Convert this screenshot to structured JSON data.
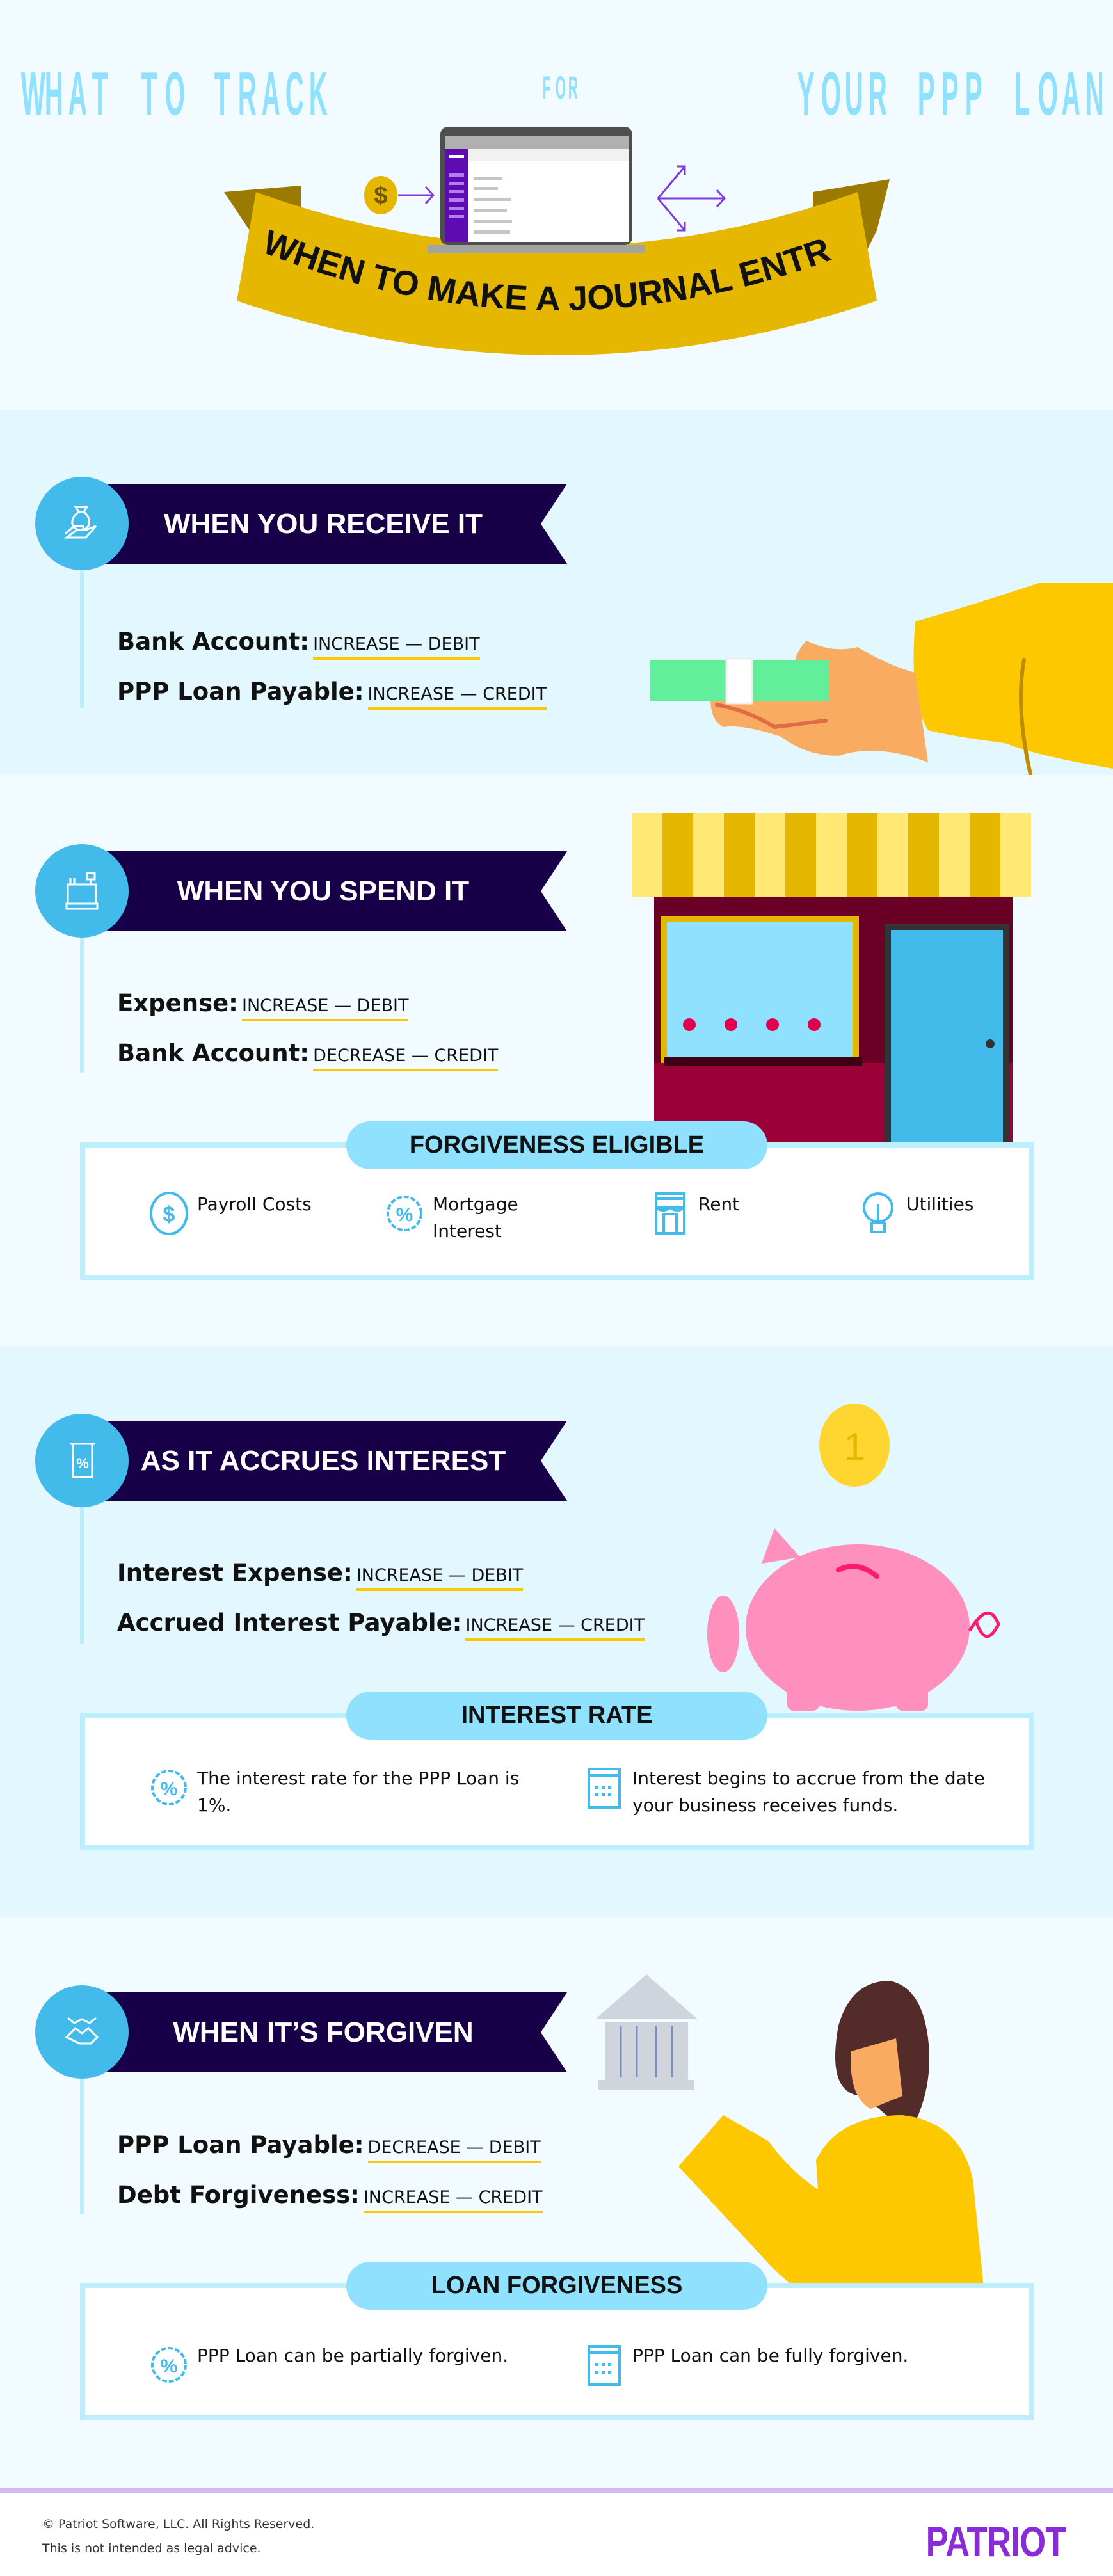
{
  "header": {
    "title_part1": "WHAT TO TRACK",
    "title_small": "FOR",
    "title_part2": "YOUR PPP LOAN",
    "ribbon_text": "WHEN TO MAKE A JOURNAL ENTRY",
    "icons": [
      "dollar-coin-icon",
      "laptop-icon",
      "branching-arrows-icon"
    ]
  },
  "colors": {
    "title": "#8fe1fd",
    "banner": "#170047",
    "circle": "#42bbeb",
    "pill": "#8fe1fd",
    "box_border": "#bdeefc",
    "underline": "#fdc800",
    "ribbon": "#e5b700",
    "logo": "#8a2bd8",
    "footer_line": "#d7b6f6"
  },
  "sections": [
    {
      "title": "WHEN YOU RECEIVE IT",
      "icon": "money-bag-hand-icon",
      "entries": [
        {
          "account": "Bank Account:",
          "value": "INCREASE — DEBIT"
        },
        {
          "account": "PPP Loan Payable:",
          "value": "INCREASE — CREDIT"
        }
      ],
      "illustration": "hand-holding-cash"
    },
    {
      "title": "WHEN YOU SPEND IT",
      "icon": "cash-register-icon",
      "entries": [
        {
          "account": "Expense:",
          "value": "INCREASE — DEBIT"
        },
        {
          "account": "Bank Account:",
          "value": "DECREASE — CREDIT"
        }
      ],
      "illustration": "storefront",
      "box": {
        "title": "FORGIVENESS ELIGIBLE",
        "items": [
          {
            "icon": "dollar-coin-icon",
            "label": "Payroll Costs"
          },
          {
            "icon": "percent-badge-icon",
            "label": "Mortgage Interest"
          },
          {
            "icon": "storefront-icon",
            "label": "Rent"
          },
          {
            "icon": "lightbulb-icon",
            "label": "Utilities"
          }
        ]
      }
    },
    {
      "title": "AS IT ACCRUES INTEREST",
      "icon": "percent-document-icon",
      "entries": [
        {
          "account": "Interest Expense:",
          "value": "INCREASE — DEBIT"
        },
        {
          "account": "Accrued Interest Payable:",
          "value": "INCREASE — CREDIT"
        }
      ],
      "illustration": "piggy-bank-with-coin",
      "box": {
        "title": "INTEREST RATE",
        "items": [
          {
            "icon": "percent-badge-icon",
            "label": "The interest rate for the PPP Loan is 1%."
          },
          {
            "icon": "calendar-icon",
            "label": "Interest begins to accrue from the date your business receives funds."
          }
        ]
      }
    },
    {
      "title": "WHEN IT’S FORGIVEN",
      "icon": "handshake-icon",
      "entries": [
        {
          "account": "PPP Loan Payable:",
          "value": "DECREASE — DEBIT"
        },
        {
          "account": "Debt Forgiveness:",
          "value": "INCREASE — CREDIT"
        }
      ],
      "illustration": "woman-holding-bank",
      "box": {
        "title": "LOAN FORGIVENESS",
        "items": [
          {
            "icon": "percent-badge-icon",
            "label": "PPP Loan can be partially forgiven."
          },
          {
            "icon": "calendar-icon",
            "label": "PPP Loan can be fully forgiven."
          }
        ]
      }
    }
  ],
  "footer": {
    "copyright": "© Patriot Software, LLC. All Rights Reserved.",
    "disclaimer": "This is not intended as legal advice.",
    "logo": "PATRIOT"
  }
}
